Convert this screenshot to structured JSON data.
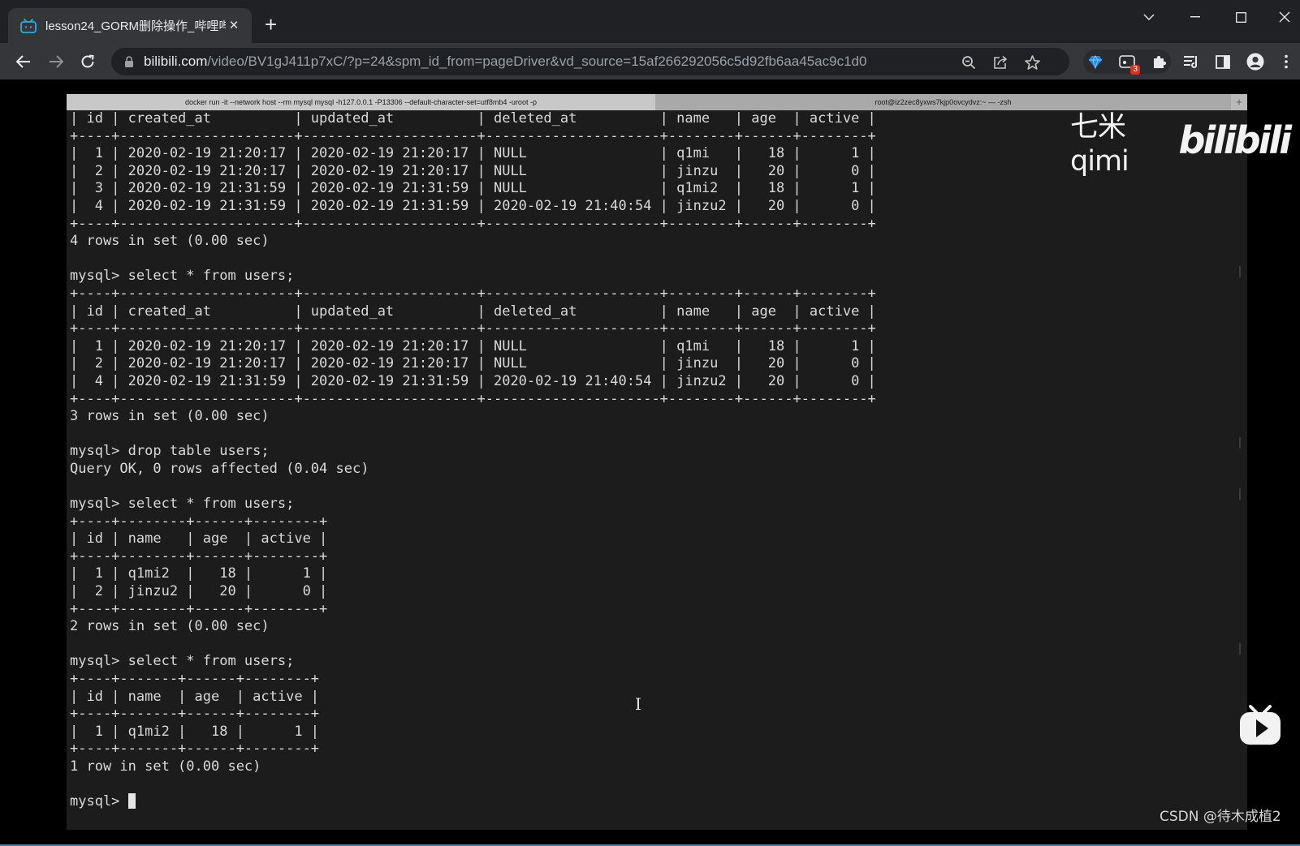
{
  "browser": {
    "tab_title": "lesson24_GORM删除操作_哔哩哔哩",
    "tab_close": "×",
    "new_tab": "+",
    "url_host": "bilibili.com",
    "url_path": "/video/BV1gJ411p7xC/?p=24&spm_id_from=pageDriver&vd_source=15af266292056c5d92fb6aa45ac9c1d0",
    "extension_badge": "3"
  },
  "terminal": {
    "tab_active": "docker run -it --network host --rm mysql mysql -h127.0.0.1 -P13306 --default-character-set=utf8mb4 -uroot -p",
    "tab_inactive": "root@iz2zec8yxws7kjp0ovcydvz:~ — -zsh",
    "tab_add": "+",
    "lines": [
      "| id | created_at          | updated_at          | deleted_at          | name   | age  | active |",
      "+----+---------------------+---------------------+---------------------+--------+------+--------+",
      "|  1 | 2020-02-19 21:20:17 | 2020-02-19 21:20:17 | NULL                | q1mi   |   18 |      1 |",
      "|  2 | 2020-02-19 21:20:17 | 2020-02-19 21:20:17 | NULL                | jinzu  |   20 |      0 |",
      "|  3 | 2020-02-19 21:31:59 | 2020-02-19 21:31:59 | NULL                | q1mi2  |   18 |      1 |",
      "|  4 | 2020-02-19 21:31:59 | 2020-02-19 21:31:59 | 2020-02-19 21:40:54 | jinzu2 |   20 |      0 |",
      "+----+---------------------+---------------------+---------------------+--------+------+--------+",
      "4 rows in set (0.00 sec)",
      "",
      "mysql> select * from users;",
      "+----+---------------------+---------------------+---------------------+--------+------+--------+",
      "| id | created_at          | updated_at          | deleted_at          | name   | age  | active |",
      "+----+---------------------+---------------------+---------------------+--------+------+--------+",
      "|  1 | 2020-02-19 21:20:17 | 2020-02-19 21:20:17 | NULL                | q1mi   |   18 |      1 |",
      "|  2 | 2020-02-19 21:20:17 | 2020-02-19 21:20:17 | NULL                | jinzu  |   20 |      0 |",
      "|  4 | 2020-02-19 21:31:59 | 2020-02-19 21:31:59 | 2020-02-19 21:40:54 | jinzu2 |   20 |      0 |",
      "+----+---------------------+---------------------+---------------------+--------+------+--------+",
      "3 rows in set (0.00 sec)",
      "",
      "mysql> drop table users;",
      "Query OK, 0 rows affected (0.04 sec)",
      "",
      "mysql> select * from users;",
      "+----+--------+------+--------+",
      "| id | name   | age  | active |",
      "+----+--------+------+--------+",
      "|  1 | q1mi2  |   18 |      1 |",
      "|  2 | jinzu2 |   20 |      0 |",
      "+----+--------+------+--------+",
      "2 rows in set (0.00 sec)",
      "",
      "mysql> select * from users;",
      "+----+-------+------+--------+",
      "| id | name  | age  | active |",
      "+----+-------+------+--------+",
      "|  1 | q1mi2 |   18 |      1 |",
      "+----+-------+------+--------+",
      "1 row in set (0.00 sec)",
      "",
      "mysql> "
    ]
  },
  "watermark": {
    "text": "七米qimi",
    "logo": "bilibili"
  },
  "csdn_watermark": "CSDN @待木成植2",
  "icons": {
    "tab_favicon": "bilibili-tv-icon",
    "back": "arrow-left-icon",
    "forward": "arrow-right-icon",
    "reload": "reload-icon",
    "lock": "lock-icon",
    "zoom": "zoom-icon",
    "share": "share-icon",
    "bookmark": "star-icon",
    "extensions": "puzzle-icon",
    "profile": "person-icon",
    "menu": "kebab-icon"
  },
  "colors": {
    "chrome_dark": "#202124",
    "chrome_toolbar": "#35363a",
    "terminal_bg": "#1c1c1c",
    "terminal_text": "#d9d9d9",
    "bilibili_blue": "#23ade5"
  }
}
